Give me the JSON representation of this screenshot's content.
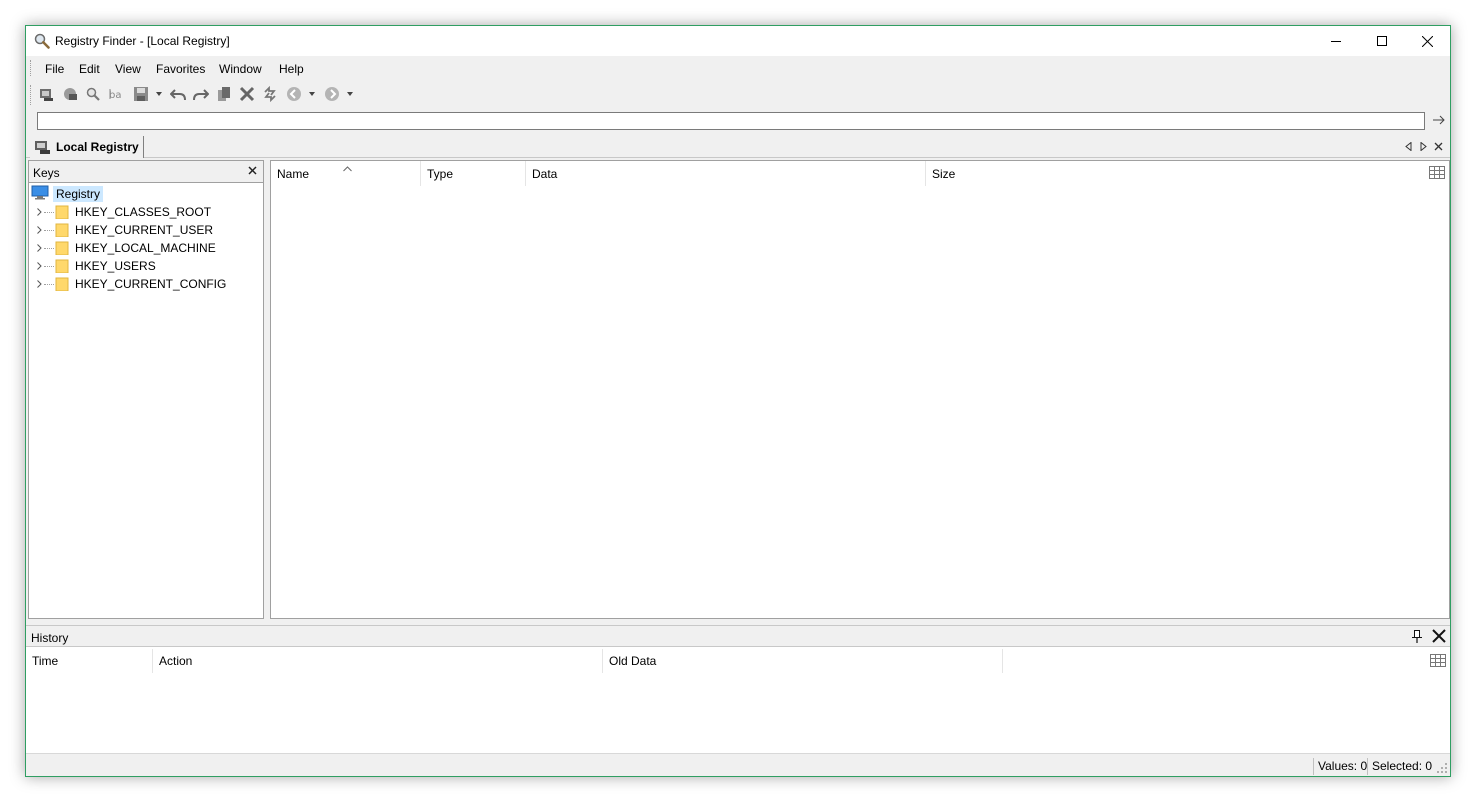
{
  "window": {
    "title": "Registry Finder - [Local Registry]",
    "app_icon": "magnifier-icon",
    "controls": [
      "minimize-icon",
      "maximize-icon",
      "close-icon"
    ]
  },
  "menu": {
    "items": [
      "File",
      "Edit",
      "View",
      "Favorites",
      "Window",
      "Help"
    ]
  },
  "toolbar": {
    "buttons": [
      "local-registry-icon",
      "remote-registry-icon",
      "find-icon",
      "replace-icon",
      "save-icon",
      "undo-icon",
      "redo-icon",
      "copy-icon",
      "delete-icon",
      "refresh-icon",
      "back-icon",
      "forward-icon"
    ]
  },
  "address": {
    "value": "",
    "placeholder": "",
    "go_icon": "arrow-right-icon"
  },
  "tab": {
    "label": "Local Registry",
    "icon": "computer-registry-icon"
  },
  "keys_panel": {
    "title": "Keys",
    "root": "Registry",
    "hives": [
      "HKEY_CLASSES_ROOT",
      "HKEY_CURRENT_USER",
      "HKEY_LOCAL_MACHINE",
      "HKEY_USERS",
      "HKEY_CURRENT_CONFIG"
    ]
  },
  "values_panel": {
    "columns": [
      "Name",
      "Type",
      "Data",
      "Size"
    ],
    "sorted_column": "Name",
    "rows": []
  },
  "history_panel": {
    "title": "History",
    "columns": [
      "Time",
      "Action",
      "Old Data"
    ],
    "rows": []
  },
  "status": {
    "values": "Values: 0",
    "selected": "Selected: 0"
  },
  "colors": {
    "window_border": "#2f9e62",
    "selection": "#cce8ff",
    "folder": "#ffd86b"
  }
}
